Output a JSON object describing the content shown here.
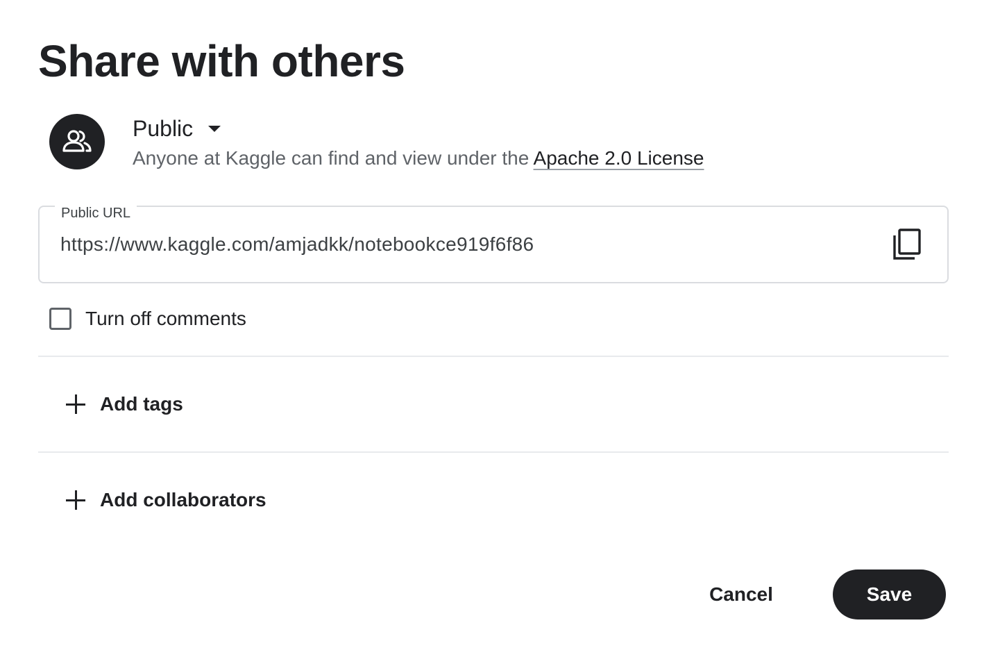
{
  "dialog": {
    "title": "Share with others"
  },
  "visibility": {
    "icon": "people-icon",
    "selected": "Public",
    "description": "Anyone at Kaggle can find and view under the ",
    "license_link": "Apache 2.0 License"
  },
  "public_url": {
    "label": "Public URL",
    "value": "https://www.kaggle.com/amjadkk/notebookce919f6f86",
    "copy_icon": "copy-icon"
  },
  "comments": {
    "label": "Turn off comments",
    "checked": false
  },
  "sections": {
    "add_tags": "Add tags",
    "add_collaborators": "Add collaborators"
  },
  "actions": {
    "cancel": "Cancel",
    "save": "Save"
  },
  "colors": {
    "primary": "#202124",
    "secondary_text": "#5f6368",
    "border": "#dadce0",
    "divider": "#e8eaed"
  }
}
